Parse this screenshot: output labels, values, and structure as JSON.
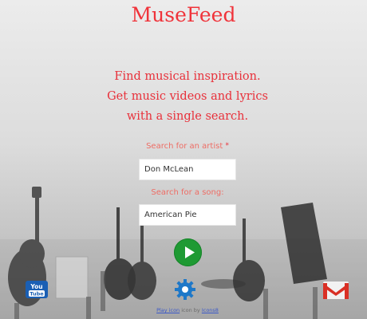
{
  "app": {
    "title": "MuseFeed"
  },
  "tagline": [
    "Find musical inspiration.",
    "Get music videos and lyrics",
    "with a single search."
  ],
  "form": {
    "artist_label": "Search for an artist",
    "artist_required_mark": "*",
    "artist_value": "Don McLean",
    "song_label": "Search for a song:",
    "song_value": "American Pie"
  },
  "icons": {
    "search_button": "play-icon",
    "youtube": "youtube-icon",
    "settings": "gear-icon",
    "email": "gmail-icon"
  },
  "credit": {
    "link1": "Play icon",
    "middle": " icon by ",
    "link2": "Icons8"
  },
  "colors": {
    "accent": "#f0333a",
    "button": "#1f9a33",
    "gear": "#1e78c8"
  }
}
